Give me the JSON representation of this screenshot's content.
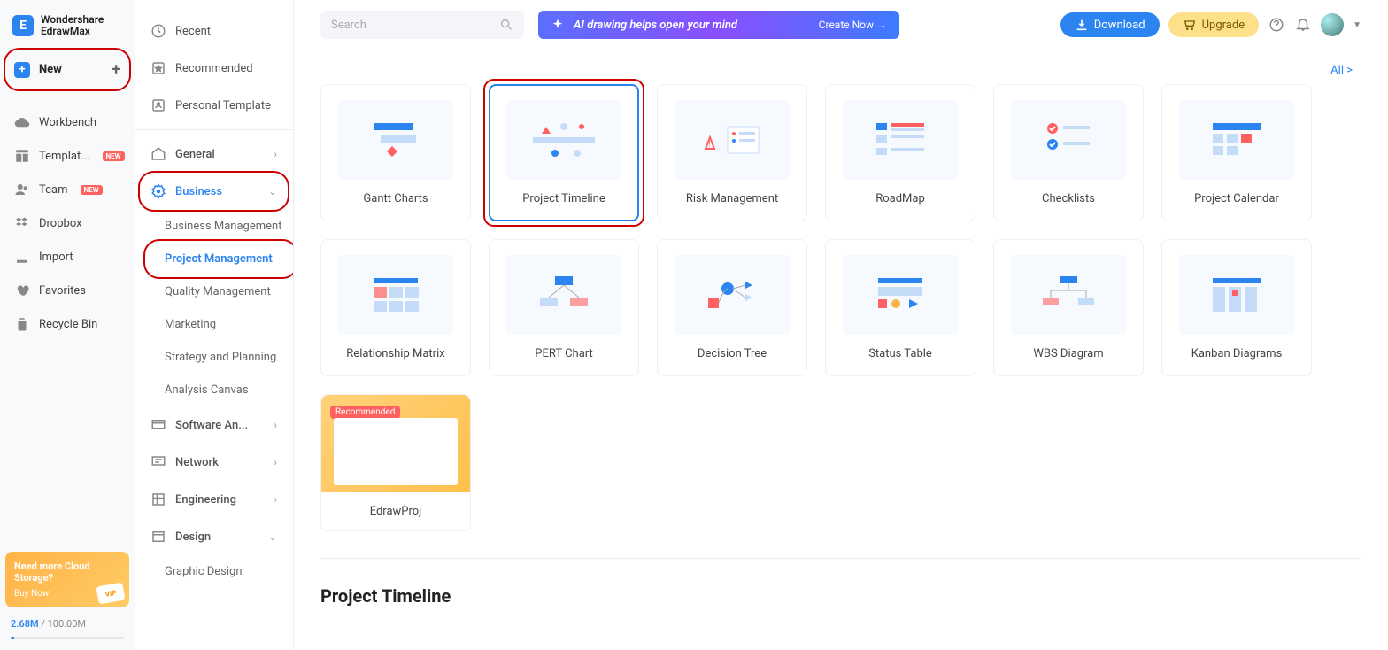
{
  "app": {
    "name_line1": "Wondershare",
    "name_line2": "EdrawMax"
  },
  "sidebar": {
    "new": "New",
    "items": [
      {
        "label": "Workbench"
      },
      {
        "label": "Templat...",
        "badge": "NEW"
      },
      {
        "label": "Team",
        "badge": "NEW"
      },
      {
        "label": "Dropbox"
      },
      {
        "label": "Import"
      },
      {
        "label": "Favorites"
      },
      {
        "label": "Recycle Bin"
      }
    ],
    "promo": {
      "line1": "Need more Cloud",
      "line2": "Storage?",
      "cta": "Buy Now",
      "vip": "VIP"
    },
    "storage": {
      "used": "2.68M",
      "total": "100.00M"
    }
  },
  "categories": {
    "top": [
      {
        "label": "Recent"
      },
      {
        "label": "Recommended"
      },
      {
        "label": "Personal Template"
      }
    ],
    "sections": [
      {
        "label": "General",
        "chev": "›"
      },
      {
        "label": "Business",
        "chev": "⌄",
        "active": true,
        "subs": [
          {
            "label": "Business Management"
          },
          {
            "label": "Project Management",
            "active": true
          },
          {
            "label": "Quality Management"
          },
          {
            "label": "Marketing"
          },
          {
            "label": "Strategy and Planning"
          },
          {
            "label": "Analysis Canvas"
          }
        ]
      },
      {
        "label": "Software An...",
        "chev": "›"
      },
      {
        "label": "Network",
        "chev": "›"
      },
      {
        "label": "Engineering",
        "chev": "›"
      },
      {
        "label": "Design",
        "chev": "⌄"
      },
      {
        "label": "Graphic Design"
      }
    ]
  },
  "topbar": {
    "search_placeholder": "Search",
    "ai_text": "AI drawing helps open your mind",
    "ai_cta": "Create Now  →",
    "download": "Download",
    "upgrade": "Upgrade"
  },
  "main": {
    "all_link": "All >",
    "templates": [
      {
        "label": "Gantt Charts"
      },
      {
        "label": "Project Timeline",
        "selected": true
      },
      {
        "label": "Risk Management"
      },
      {
        "label": "RoadMap"
      },
      {
        "label": "Checklists"
      },
      {
        "label": "Project Calendar"
      },
      {
        "label": "Relationship Matrix"
      },
      {
        "label": "PERT Chart"
      },
      {
        "label": "Decision Tree"
      },
      {
        "label": "Status Table"
      },
      {
        "label": "WBS Diagram"
      },
      {
        "label": "Kanban Diagrams"
      }
    ],
    "edrawproj": {
      "label": "EdrawProj",
      "badge": "Recommended"
    },
    "section_title": "Project Timeline"
  }
}
